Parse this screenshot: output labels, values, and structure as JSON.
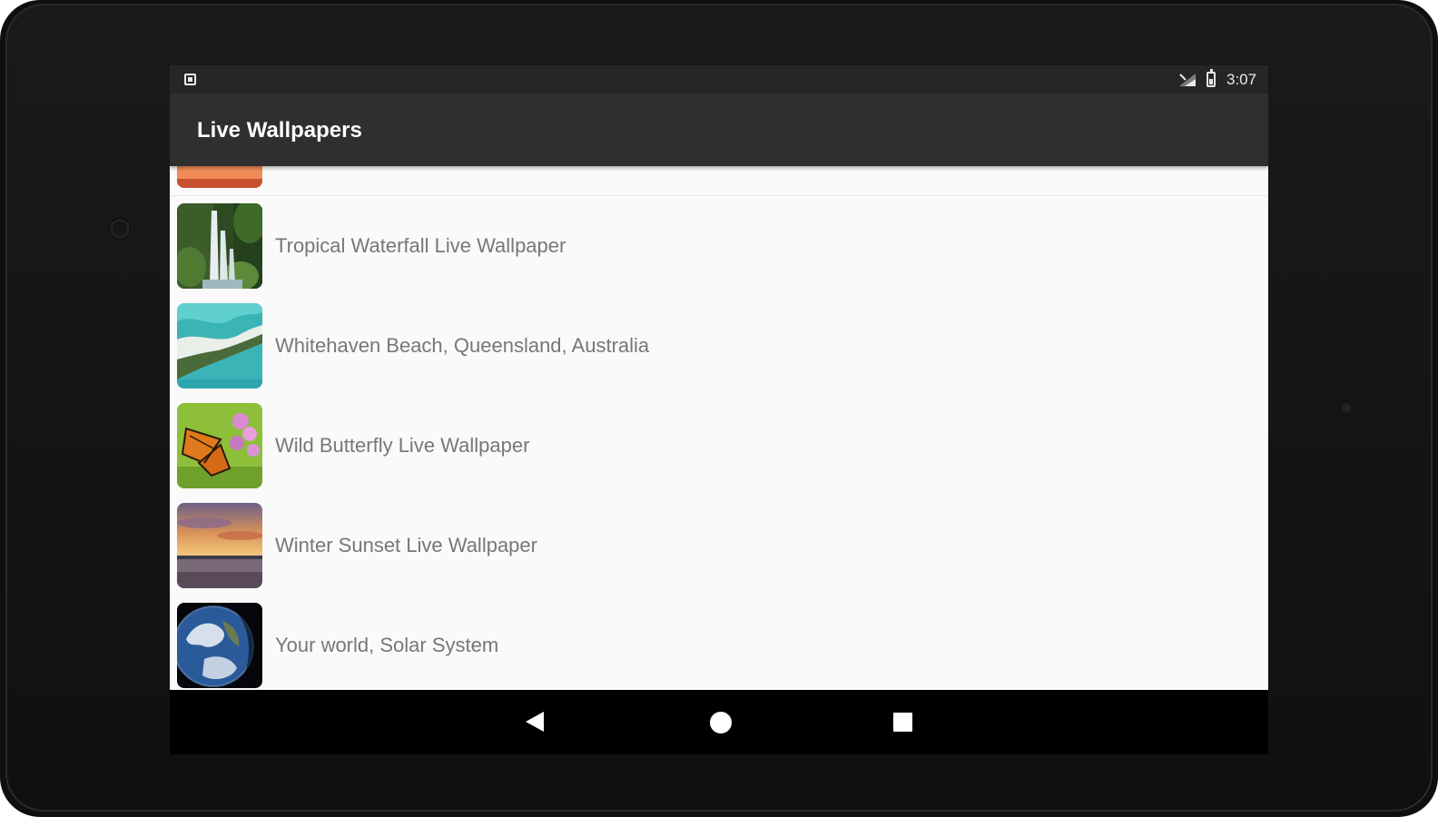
{
  "statusbar": {
    "time": "3:07",
    "icons": [
      "notification-icon",
      "signal-icon",
      "battery-icon"
    ]
  },
  "appbar": {
    "title": "Live Wallpapers"
  },
  "wallpapers": [
    {
      "label": "",
      "thumb": "orange-partial"
    },
    {
      "label": "Tropical Waterfall Live Wallpaper",
      "thumb": "waterfall"
    },
    {
      "label": "Whitehaven Beach, Queensland, Australia",
      "thumb": "beach"
    },
    {
      "label": "Wild Butterfly Live Wallpaper",
      "thumb": "butterfly"
    },
    {
      "label": "Winter Sunset Live Wallpaper",
      "thumb": "sunset"
    },
    {
      "label": "Your world, Solar System",
      "thumb": "earth"
    }
  ],
  "navbar": {
    "icons": [
      "back-icon",
      "home-icon",
      "recents-icon"
    ]
  },
  "colors": {
    "statusbar": "#262626",
    "appbar": "#2f2f2f",
    "list_bg": "#fafafa",
    "label_text": "#777777",
    "navbar": "#000000"
  }
}
